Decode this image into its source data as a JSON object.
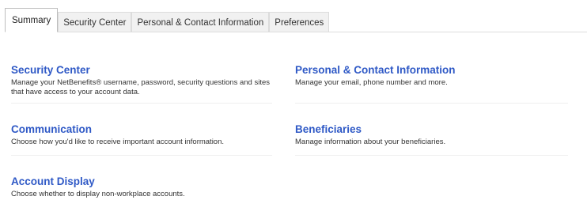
{
  "tabs": [
    {
      "label": "Summary",
      "active": true
    },
    {
      "label": "Security Center",
      "active": false
    },
    {
      "label": "Personal & Contact Information",
      "active": false
    },
    {
      "label": "Preferences",
      "active": false
    }
  ],
  "cards": {
    "security_center": {
      "title": "Security Center",
      "desc": "Manage your NetBenefits® username, password, security questions and sites that have access to your account data."
    },
    "personal_contact": {
      "title": "Personal & Contact Information",
      "desc": "Manage your email, phone number and more."
    },
    "communication": {
      "title": "Communication",
      "desc": "Choose how you'd like to receive important account information."
    },
    "beneficiaries": {
      "title": "Beneficiaries",
      "desc": "Manage information about your beneficiaries."
    },
    "account_display": {
      "title": "Account Display",
      "desc": "Choose whether to display non-workplace accounts."
    }
  },
  "colors": {
    "link": "#2f59c6",
    "text": "#333333"
  }
}
